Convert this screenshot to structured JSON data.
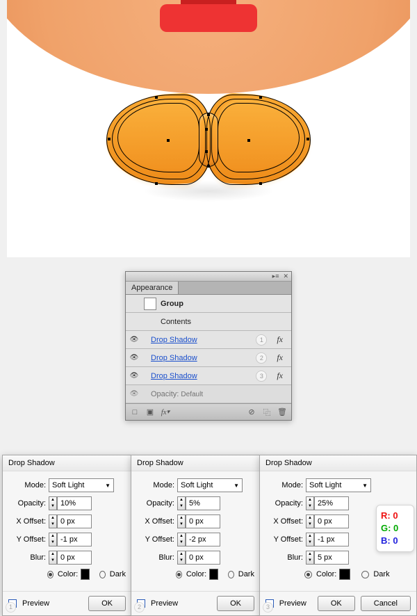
{
  "appearance": {
    "tab": "Appearance",
    "group": "Group",
    "contents": "Contents",
    "items": [
      {
        "label": "Drop Shadow",
        "num": "1"
      },
      {
        "label": "Drop Shadow",
        "num": "2"
      },
      {
        "label": "Drop Shadow",
        "num": "3"
      }
    ],
    "opacity_label": "Opacity:",
    "opacity_value": "Default"
  },
  "ds": [
    {
      "title": "Drop Shadow",
      "num": "1",
      "mode_label": "Mode:",
      "mode": "Soft Light",
      "opacity_label": "Opacity:",
      "opacity": "10%",
      "x_label": "X Offset:",
      "x": "0 px",
      "y_label": "Y Offset:",
      "y": "-1 px",
      "blur_label": "Blur:",
      "blur": "0 px",
      "color_label": "Color:",
      "dark_label": "Dark",
      "preview": "Preview",
      "ok": "OK"
    },
    {
      "title": "Drop Shadow",
      "num": "2",
      "mode_label": "Mode:",
      "mode": "Soft Light",
      "opacity_label": "Opacity:",
      "opacity": "5%",
      "x_label": "X Offset:",
      "x": "0 px",
      "y_label": "Y Offset:",
      "y": "-2 px",
      "blur_label": "Blur:",
      "blur": "0 px",
      "color_label": "Color:",
      "dark_label": "Dark",
      "preview": "Preview",
      "ok": "OK"
    },
    {
      "title": "Drop Shadow",
      "num": "3",
      "mode_label": "Mode:",
      "mode": "Soft Light",
      "opacity_label": "Opacity:",
      "opacity": "25%",
      "x_label": "X Offset:",
      "x": "0 px",
      "y_label": "Y Offset:",
      "y": "-1 px",
      "blur_label": "Blur:",
      "blur": "5 px",
      "color_label": "Color:",
      "dark_label": "Dark",
      "preview": "Preview",
      "ok": "OK",
      "cancel": "Cancel"
    }
  ],
  "rgb": {
    "r": "R: 0",
    "g": "G: 0",
    "b": "B: 0"
  }
}
